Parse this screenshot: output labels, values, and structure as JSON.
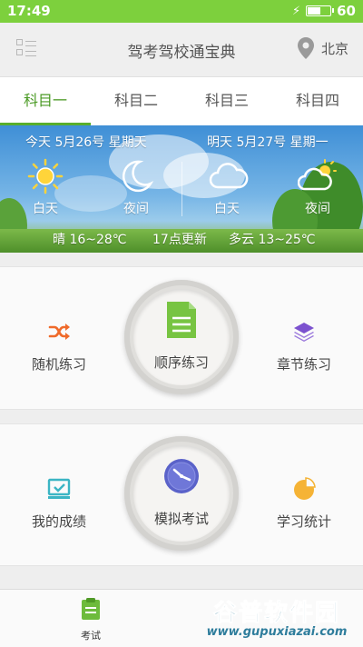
{
  "status_bar": {
    "time": "17:49",
    "battery": "60",
    "battery_level": 0.6
  },
  "header": {
    "title": "驾考驾校通宝典",
    "location": "北京"
  },
  "tabs": [
    {
      "label": "科目一",
      "active": true
    },
    {
      "label": "科目二",
      "active": false
    },
    {
      "label": "科目三",
      "active": false
    },
    {
      "label": "科目四",
      "active": false
    }
  ],
  "weather": {
    "today_label": "今天 5月26号 星期天",
    "tomorrow_label": "明天 5月27号 星期一",
    "slots": [
      {
        "label": "白天",
        "icon": "sun-icon"
      },
      {
        "label": "夜间",
        "icon": "moon-icon"
      },
      {
        "label": "白天",
        "icon": "cloud-icon"
      },
      {
        "label": "夜间",
        "icon": "partly-cloudy-icon"
      }
    ],
    "today_temp": "晴 16~28℃",
    "update_time": "17点更新",
    "tomorrow_temp": "多云 13~25℃"
  },
  "practice": {
    "random": "随机练习",
    "sequential": "顺序练习",
    "chapter": "章节练习"
  },
  "exam": {
    "my_scores": "我的成绩",
    "mock_exam": "模拟考试",
    "study_stats": "学习统计"
  },
  "bottom_nav": {
    "exam_label": "考试"
  },
  "watermark": {
    "title": "谷普软件园",
    "url": "www.gupuxiazai.com"
  },
  "colors": {
    "status_bar": "#7dd03d",
    "accent_green": "#58ae2b",
    "mock_exam_blue": "#5a62c9"
  }
}
